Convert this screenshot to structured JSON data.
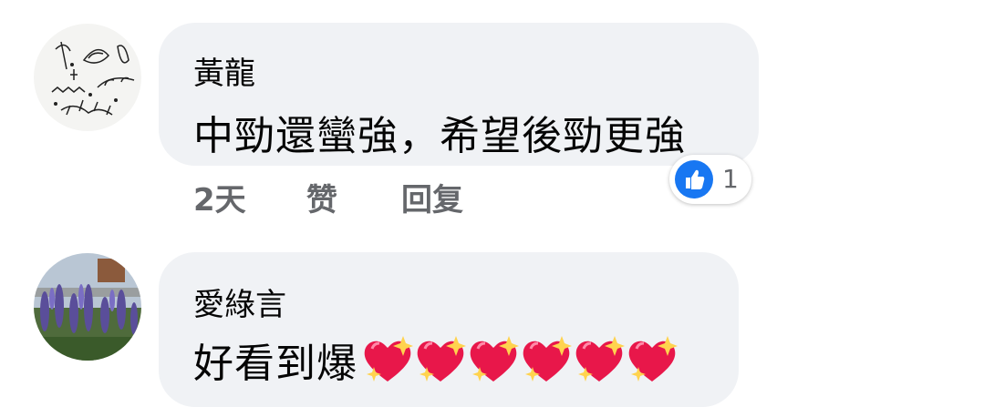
{
  "comments": [
    {
      "author": "黃龍",
      "text": "中勁還蠻強，希望後勁更強",
      "time": "2天",
      "like_label": "赞",
      "reply_label": "回复",
      "reaction_count": "1",
      "reaction_icon": "thumbs-up-icon",
      "avatar": "botanical-sketch-avatar"
    },
    {
      "author": "愛綠言",
      "text": "好看到爆",
      "emoji": [
        "sparkling-heart",
        "sparkling-heart",
        "sparkling-heart",
        "sparkling-heart",
        "sparkling-heart",
        "sparkling-heart"
      ],
      "avatar": "lavender-field-avatar"
    }
  ],
  "colors": {
    "bubble": "#f0f2f5",
    "like_blue": "#1877f2",
    "meta_gray": "#65676b",
    "heart": "#e8174a"
  }
}
